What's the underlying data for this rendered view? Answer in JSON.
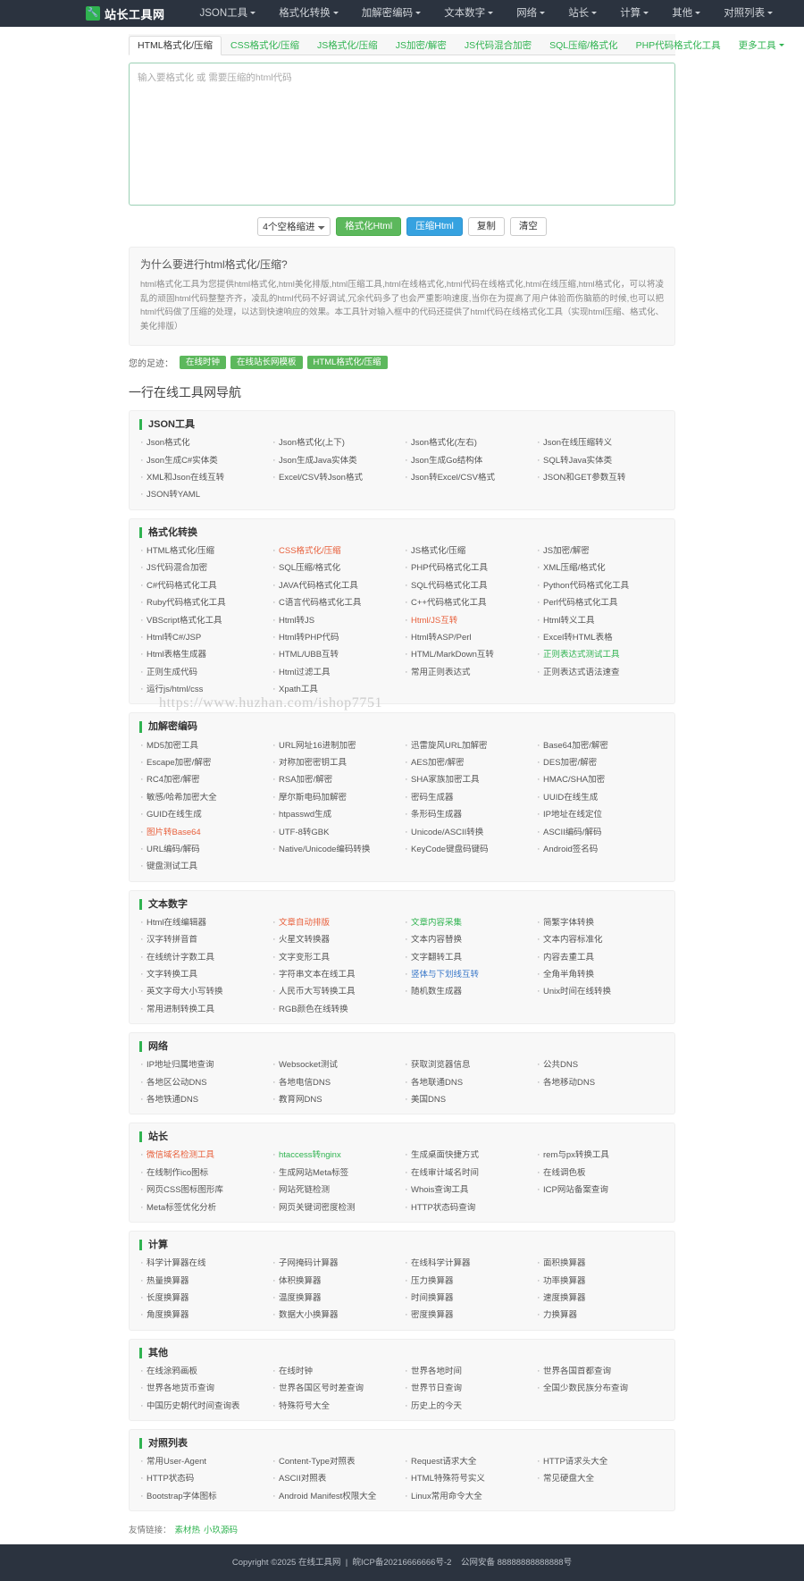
{
  "navbar": {
    "brand": "站长工具网",
    "logo_icon": "wrench-icon",
    "items": [
      {
        "label": "JSON工具",
        "caret": true
      },
      {
        "label": "格式化转换",
        "caret": true
      },
      {
        "label": "加解密编码",
        "caret": true
      },
      {
        "label": "文本数字",
        "caret": true
      },
      {
        "label": "网络",
        "caret": true
      },
      {
        "label": "站长",
        "caret": true
      },
      {
        "label": "计算",
        "caret": true
      },
      {
        "label": "其他",
        "caret": true
      },
      {
        "label": "对照列表",
        "caret": true
      }
    ]
  },
  "tabs": [
    {
      "label": "HTML格式化/压缩",
      "active": true
    },
    {
      "label": "CSS格式化/压缩",
      "active": false
    },
    {
      "label": "JS格式化/压缩",
      "active": false
    },
    {
      "label": "JS加密/解密",
      "active": false
    },
    {
      "label": "JS代码混合加密",
      "active": false
    },
    {
      "label": "SQL压缩/格式化",
      "active": false
    },
    {
      "label": "PHP代码格式化工具",
      "active": false
    },
    {
      "label": "更多工具",
      "active": false,
      "caret": true
    }
  ],
  "editor": {
    "placeholder": "输入要格式化 或 需要压缩的html代码",
    "value": ""
  },
  "toolbar": {
    "indent_selected": "4个空格缩进",
    "indent_options": [
      "4个空格缩进"
    ],
    "format_label": "格式化Html",
    "compress_label": "压缩Html",
    "copy_label": "复制",
    "clear_label": "清空"
  },
  "info": {
    "title": "为什么要进行html格式化/压缩?",
    "body": "html格式化工具为您提供html格式化,html美化排版,html压缩工具,html在线格式化,html代码在线格式化,html在线压缩,html格式化，可以将凌乱的顽固html代码整整齐齐，凌乱的html代码不好调试,冗余代码多了也会严重影响速度,当你在为提高了用户体验而伤脑筋的时候,也可以把html代码做了压缩的处理，以达到快速响应的效果。本工具针对输入框中的代码还提供了html代码在线格式化工具（实现html压缩、格式化、美化排版）"
  },
  "footprint": {
    "label": "您的足迹：",
    "tags": [
      "在线时钟",
      "在线站长网模板",
      "HTML格式化/压缩"
    ]
  },
  "directory": {
    "heading": "一行在线工具网导航",
    "sections": [
      {
        "title": "JSON工具",
        "links": [
          {
            "label": "Json格式化"
          },
          {
            "label": "Json格式化(上下)"
          },
          {
            "label": "Json格式化(左右)"
          },
          {
            "label": "Json在线压缩转义"
          },
          {
            "label": "Json生成C#实体类"
          },
          {
            "label": "Json生成Java实体类"
          },
          {
            "label": "Json生成Go结构体"
          },
          {
            "label": "SQL转Java实体类"
          },
          {
            "label": "XML和Json在线互转"
          },
          {
            "label": "Excel/CSV转Json格式"
          },
          {
            "label": "Json转Excel/CSV格式"
          },
          {
            "label": "JSON和GET参数互转"
          },
          {
            "label": "JSON转YAML"
          }
        ]
      },
      {
        "title": "格式化转换",
        "links": [
          {
            "label": "HTML格式化/压缩"
          },
          {
            "label": "CSS格式化/压缩",
            "color": "c-red"
          },
          {
            "label": "JS格式化/压缩"
          },
          {
            "label": "JS加密/解密"
          },
          {
            "label": "JS代码混合加密"
          },
          {
            "label": "SQL压缩/格式化"
          },
          {
            "label": "PHP代码格式化工具"
          },
          {
            "label": "XML压缩/格式化"
          },
          {
            "label": "C#代码格式化工具"
          },
          {
            "label": "JAVA代码格式化工具"
          },
          {
            "label": "SQL代码格式化工具"
          },
          {
            "label": "Python代码格式化工具"
          },
          {
            "label": "Ruby代码格式化工具"
          },
          {
            "label": "C语言代码格式化工具"
          },
          {
            "label": "C++代码格式化工具"
          },
          {
            "label": "Perl代码格式化工具"
          },
          {
            "label": "VBScript格式化工具"
          },
          {
            "label": "Html转JS"
          },
          {
            "label": "Html/JS互转",
            "color": "c-red"
          },
          {
            "label": "Html转义工具"
          },
          {
            "label": "Html转C#/JSP"
          },
          {
            "label": "Html转PHP代码"
          },
          {
            "label": "Html转ASP/Perl"
          },
          {
            "label": "Excel转HTML表格"
          },
          {
            "label": "Html表格生成器"
          },
          {
            "label": "HTML/UBB互转"
          },
          {
            "label": "HTML/MarkDown互转"
          },
          {
            "label": "正则表达式测试工具",
            "color": "c-green"
          },
          {
            "label": "正则生成代码"
          },
          {
            "label": "Html过滤工具"
          },
          {
            "label": "常用正则表达式"
          },
          {
            "label": "正则表达式语法速查"
          },
          {
            "label": "运行js/html/css"
          },
          {
            "label": "Xpath工具"
          }
        ]
      },
      {
        "title": "加解密编码",
        "links": [
          {
            "label": "MD5加密工具"
          },
          {
            "label": "URL网址16进制加密"
          },
          {
            "label": "迅雷旋风URL加解密"
          },
          {
            "label": "Base64加密/解密"
          },
          {
            "label": "Escape加密/解密"
          },
          {
            "label": "对称加密密钥工具"
          },
          {
            "label": "AES加密/解密"
          },
          {
            "label": "DES加密/解密"
          },
          {
            "label": "RC4加密/解密"
          },
          {
            "label": "RSA加密/解密"
          },
          {
            "label": "SHA家族加密工具"
          },
          {
            "label": "HMAC/SHA加密"
          },
          {
            "label": "敏感/哈希加密大全"
          },
          {
            "label": "摩尔斯电码加解密"
          },
          {
            "label": "密码生成器"
          },
          {
            "label": "UUID在线生成"
          },
          {
            "label": "GUID在线生成"
          },
          {
            "label": "htpasswd生成"
          },
          {
            "label": "条形码生成器"
          },
          {
            "label": "IP地址在线定位"
          },
          {
            "label": "图片转Base64",
            "color": "c-red"
          },
          {
            "label": "UTF-8转GBK"
          },
          {
            "label": "Unicode/ASCII转换"
          },
          {
            "label": "ASCII编码/解码"
          },
          {
            "label": "URL编码/解码"
          },
          {
            "label": "Native/Unicode编码转换"
          },
          {
            "label": "KeyCode键盘码键码"
          },
          {
            "label": "Android签名码"
          },
          {
            "label": "键盘测试工具"
          }
        ]
      },
      {
        "title": "文本数字",
        "links": [
          {
            "label": "Html在线编辑器"
          },
          {
            "label": "文章自动排版",
            "color": "c-red"
          },
          {
            "label": "文章内容采集",
            "color": "c-green"
          },
          {
            "label": "简繁字体转换"
          },
          {
            "label": "汉字转拼音首"
          },
          {
            "label": "火星文转换器"
          },
          {
            "label": "文本内容替换"
          },
          {
            "label": "文本内容标准化"
          },
          {
            "label": "在线统计字数工具"
          },
          {
            "label": "文字变形工具"
          },
          {
            "label": "文字翻转工具"
          },
          {
            "label": "内容去重工具"
          },
          {
            "label": "文字转换工具"
          },
          {
            "label": "字符串文本在线工具"
          },
          {
            "label": "竖体与下划线互转",
            "color": "c-blue"
          },
          {
            "label": "全角半角转换"
          },
          {
            "label": "英文字母大小写转换"
          },
          {
            "label": "人民币大写转换工具"
          },
          {
            "label": "随机数生成器"
          },
          {
            "label": "Unix时间在线转换"
          },
          {
            "label": "常用进制转换工具"
          },
          {
            "label": "RGB颜色在线转换"
          }
        ]
      },
      {
        "title": "网络",
        "links": [
          {
            "label": "IP地址归属地查询"
          },
          {
            "label": "Websocket测试"
          },
          {
            "label": "获取浏览器信息"
          },
          {
            "label": "公共DNS"
          },
          {
            "label": "各地区公动DNS"
          },
          {
            "label": "各地电信DNS"
          },
          {
            "label": "各地联通DNS"
          },
          {
            "label": "各地移动DNS"
          },
          {
            "label": "各地铁通DNS"
          },
          {
            "label": "教育网DNS"
          },
          {
            "label": "美国DNS"
          }
        ]
      },
      {
        "title": "站长",
        "links": [
          {
            "label": "微信域名检测工具",
            "color": "c-red"
          },
          {
            "label": "htaccess转nginx",
            "color": "c-green"
          },
          {
            "label": "生成桌面快捷方式"
          },
          {
            "label": "rem与px转换工具"
          },
          {
            "label": "在线制作ico图标"
          },
          {
            "label": "生成网站Meta标签"
          },
          {
            "label": "在线审计域名时间"
          },
          {
            "label": "在线调色板"
          },
          {
            "label": "网页CSS图标图形库"
          },
          {
            "label": "网站死链检测"
          },
          {
            "label": "Whois查询工具"
          },
          {
            "label": "ICP网站备案查询"
          },
          {
            "label": "Meta标签优化分析"
          },
          {
            "label": "网页关键词密度检测"
          },
          {
            "label": "HTTP状态码查询"
          }
        ]
      },
      {
        "title": "计算",
        "links": [
          {
            "label": "科学计算器在线"
          },
          {
            "label": "子网掩码计算器"
          },
          {
            "label": "在线科学计算器"
          },
          {
            "label": "面积换算器"
          },
          {
            "label": "热量换算器"
          },
          {
            "label": "体积换算器"
          },
          {
            "label": "压力换算器"
          },
          {
            "label": "功率换算器"
          },
          {
            "label": "长度换算器"
          },
          {
            "label": "温度换算器"
          },
          {
            "label": "时间换算器"
          },
          {
            "label": "速度换算器"
          },
          {
            "label": "角度换算器"
          },
          {
            "label": "数据大小换算器"
          },
          {
            "label": "密度换算器"
          },
          {
            "label": "力换算器"
          }
        ]
      },
      {
        "title": "其他",
        "links": [
          {
            "label": "在线涂鸦画板"
          },
          {
            "label": "在线时钟"
          },
          {
            "label": "世界各地时间"
          },
          {
            "label": "世界各国首都查询"
          },
          {
            "label": "世界各地货币查询"
          },
          {
            "label": "世界各国区号时差查询"
          },
          {
            "label": "世界节日查询"
          },
          {
            "label": "全国少数民族分布查询"
          },
          {
            "label": "中国历史朝代时间查询表"
          },
          {
            "label": "特殊符号大全"
          },
          {
            "label": "历史上的今天"
          }
        ]
      },
      {
        "title": "对照列表",
        "links": [
          {
            "label": "常用User-Agent"
          },
          {
            "label": "Content-Type对照表"
          },
          {
            "label": "Request请求大全"
          },
          {
            "label": "HTTP请求头大全"
          },
          {
            "label": "HTTP状态码"
          },
          {
            "label": "ASCII对照表"
          },
          {
            "label": "HTML特殊符号实义"
          },
          {
            "label": "常见硬盘大全"
          },
          {
            "label": "Bootstrap字体图标"
          },
          {
            "label": "Android Manifest权限大全"
          },
          {
            "label": "Linux常用命令大全"
          }
        ]
      }
    ]
  },
  "friendly": {
    "label": "友情链接：",
    "links": [
      "素材热",
      "小玖源码"
    ]
  },
  "footer": {
    "text": "Copyright ©2025 在线工具网",
    "icp": "皖ICP备20216666666号-2",
    "police": "公网安备 88888888888888号"
  },
  "watermark": "https://www.huzhan.com/ishop7751"
}
